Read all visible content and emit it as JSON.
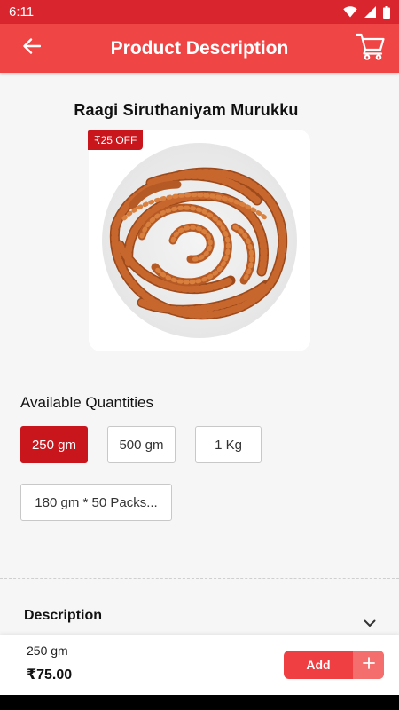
{
  "status_bar": {
    "time": "6:11"
  },
  "app_bar": {
    "title": "Product Description"
  },
  "product": {
    "name": "Raagi Siruthaniyam Murukku",
    "offer_badge": "₹25 OFF"
  },
  "quantities": {
    "label": "Available Quantities",
    "options": [
      "250 gm",
      "500 gm",
      "1 Kg",
      "180 gm * 50 Packs..."
    ],
    "selected": "250 gm"
  },
  "description": {
    "title": "Description"
  },
  "bottom_bar": {
    "quantity": "250 gm",
    "price": "₹75.00",
    "add_label": "Add"
  },
  "colors": {
    "status_bar": "#d9252d",
    "app_bar": "#f04545",
    "accent": "#c9161d",
    "add_button": "#ef3f43"
  },
  "icons": [
    "wifi-icon",
    "signal-icon",
    "battery-icon",
    "back-arrow-icon",
    "cart-icon",
    "chevron-down-icon",
    "plus-icon"
  ]
}
